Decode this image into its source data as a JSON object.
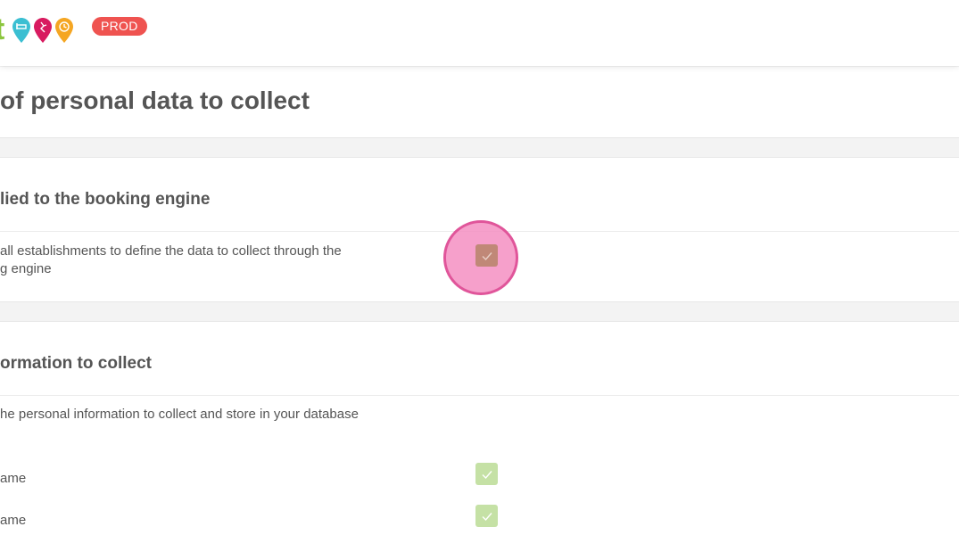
{
  "header": {
    "logo_letter": "t",
    "env_badge": "PROD",
    "pins": [
      {
        "icon": "bed-pin-icon",
        "color": "#3bbfd2"
      },
      {
        "icon": "activity-pin-icon",
        "color": "#d81b60"
      },
      {
        "icon": "clock-pin-icon",
        "color": "#f5a623"
      }
    ]
  },
  "page": {
    "title": "of personal data to collect"
  },
  "booking_engine_card": {
    "title": "lied to the booking engine",
    "setting_line1": "all establishments to define the data to collect through the",
    "setting_line2": "g engine",
    "checked": true
  },
  "information_card": {
    "title": "ormation to collect",
    "description": "he personal information to collect and store in your database",
    "fields": [
      {
        "label": "ame",
        "checked": true
      },
      {
        "label": "ame",
        "checked": true
      }
    ]
  },
  "colors": {
    "accent_green": "#8cc63f",
    "badge_red": "#ef5350",
    "check_green": "#c5e1a5",
    "check_active": "#c08877",
    "click_highlight": "#f48fc2"
  }
}
